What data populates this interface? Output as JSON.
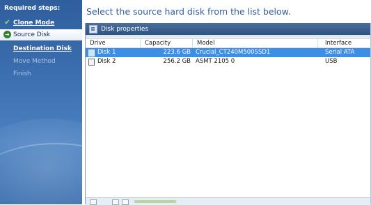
{
  "sidebar": {
    "title": "Required steps:",
    "steps": [
      {
        "label": "Clone Mode",
        "state": "done",
        "icon": "check-icon"
      },
      {
        "label": "Source Disk",
        "state": "current",
        "icon": "arrow-right-circle-icon"
      },
      {
        "label": "Destination Disk",
        "state": "next"
      },
      {
        "label": "Move Method",
        "state": "disabled"
      },
      {
        "label": "Finish",
        "state": "disabled"
      }
    ]
  },
  "main": {
    "instruction": "Select the source hard disk from the list below.",
    "panel_title": "Disk properties"
  },
  "table": {
    "columns": [
      "Drive",
      "Capacity",
      "Model",
      "Interface"
    ],
    "rows": [
      {
        "drive": "Disk 1",
        "capacity": "223.6 GB",
        "model": "Crucial_CT240M500SSD1",
        "interface": "Serial ATA",
        "selected": true
      },
      {
        "drive": "Disk 2",
        "capacity": "256.2 GB",
        "model": "ASMT 2105 0",
        "interface": "USB",
        "selected": false
      }
    ]
  },
  "colors": {
    "sidebar_blue": "#3f73b4",
    "selection_blue": "#3d8ee6",
    "instruction_text": "#2f5e9d",
    "check_green": "#9be36f"
  }
}
